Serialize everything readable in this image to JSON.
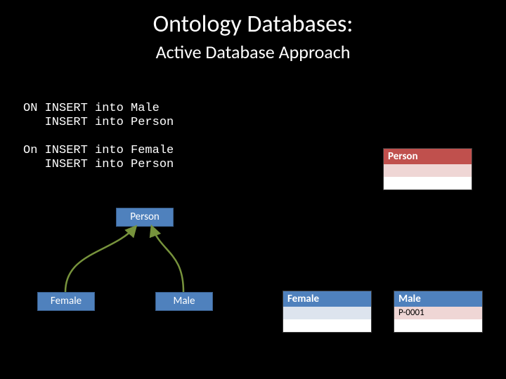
{
  "title": "Ontology Databases:",
  "subtitle": "Active Database Approach",
  "triggers": {
    "male": "ON INSERT into Male\n   INSERT into Person",
    "female": "On INSERT into Female\n   INSERT into Person"
  },
  "ontology": {
    "root": "Person",
    "left_child": "Female",
    "right_child": "Male"
  },
  "tables": {
    "person": {
      "header": "Person",
      "rows": [
        "",
        ""
      ]
    },
    "female": {
      "header": "Female",
      "rows": [
        "",
        ""
      ]
    },
    "male": {
      "header": "Male",
      "rows": [
        "P-0001",
        ""
      ]
    }
  }
}
